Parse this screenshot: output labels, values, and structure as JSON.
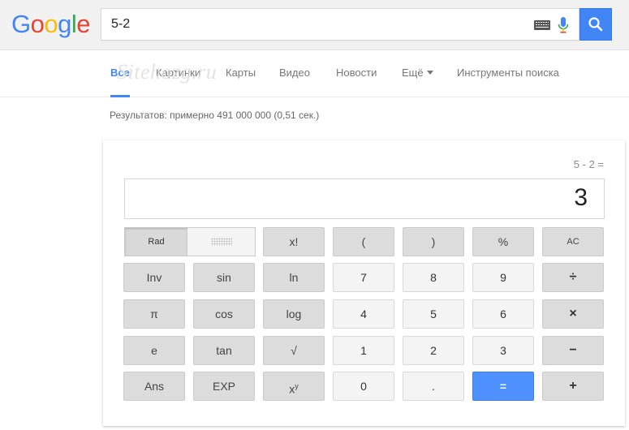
{
  "header": {
    "logo": [
      "G",
      "o",
      "o",
      "g",
      "l",
      "e"
    ],
    "logo_colors": [
      "#4285f4",
      "#ea4335",
      "#fbbc05",
      "#4285f4",
      "#34a853",
      "#ea4335"
    ],
    "search_value": "5-2",
    "icons": {
      "keyboard": "keyboard-icon",
      "mic": "mic-icon",
      "search": "search-icon"
    }
  },
  "tabs": [
    {
      "label": "Все",
      "active": true
    },
    {
      "label": "Картинки"
    },
    {
      "label": "Карты"
    },
    {
      "label": "Видео"
    },
    {
      "label": "Новости"
    },
    {
      "label": "Ещё"
    },
    {
      "label": "Инструменты поиска"
    }
  ],
  "watermark": "Sitehozg.ru",
  "results_stats": "Результатов: примерно 491 000 000 (0,51 сек.)",
  "calculator": {
    "history": "5 - 2 =",
    "display": "3",
    "toggle": {
      "rad": "Rad"
    },
    "keys": {
      "fact": "x!",
      "lparen": "(",
      "rparen": ")",
      "percent": "%",
      "ac": "AC",
      "inv": "Inv",
      "sin": "sin",
      "ln": "ln",
      "k7": "7",
      "k8": "8",
      "k9": "9",
      "div": "÷",
      "pi": "π",
      "cos": "cos",
      "log": "log",
      "k4": "4",
      "k5": "5",
      "k6": "6",
      "mul": "×",
      "e": "e",
      "tan": "tan",
      "sqrt": "√",
      "k1": "1",
      "k2": "2",
      "k3": "3",
      "sub": "−",
      "ans": "Ans",
      "exp": "EXP",
      "pow_base": "x",
      "pow_exp": "y",
      "k0": "0",
      "dot": ".",
      "eq": "=",
      "add": "+"
    },
    "colors": {
      "accent": "#4d90fe",
      "fn_key": "#dcdcdc",
      "num_key": "#f4f4f4"
    }
  }
}
